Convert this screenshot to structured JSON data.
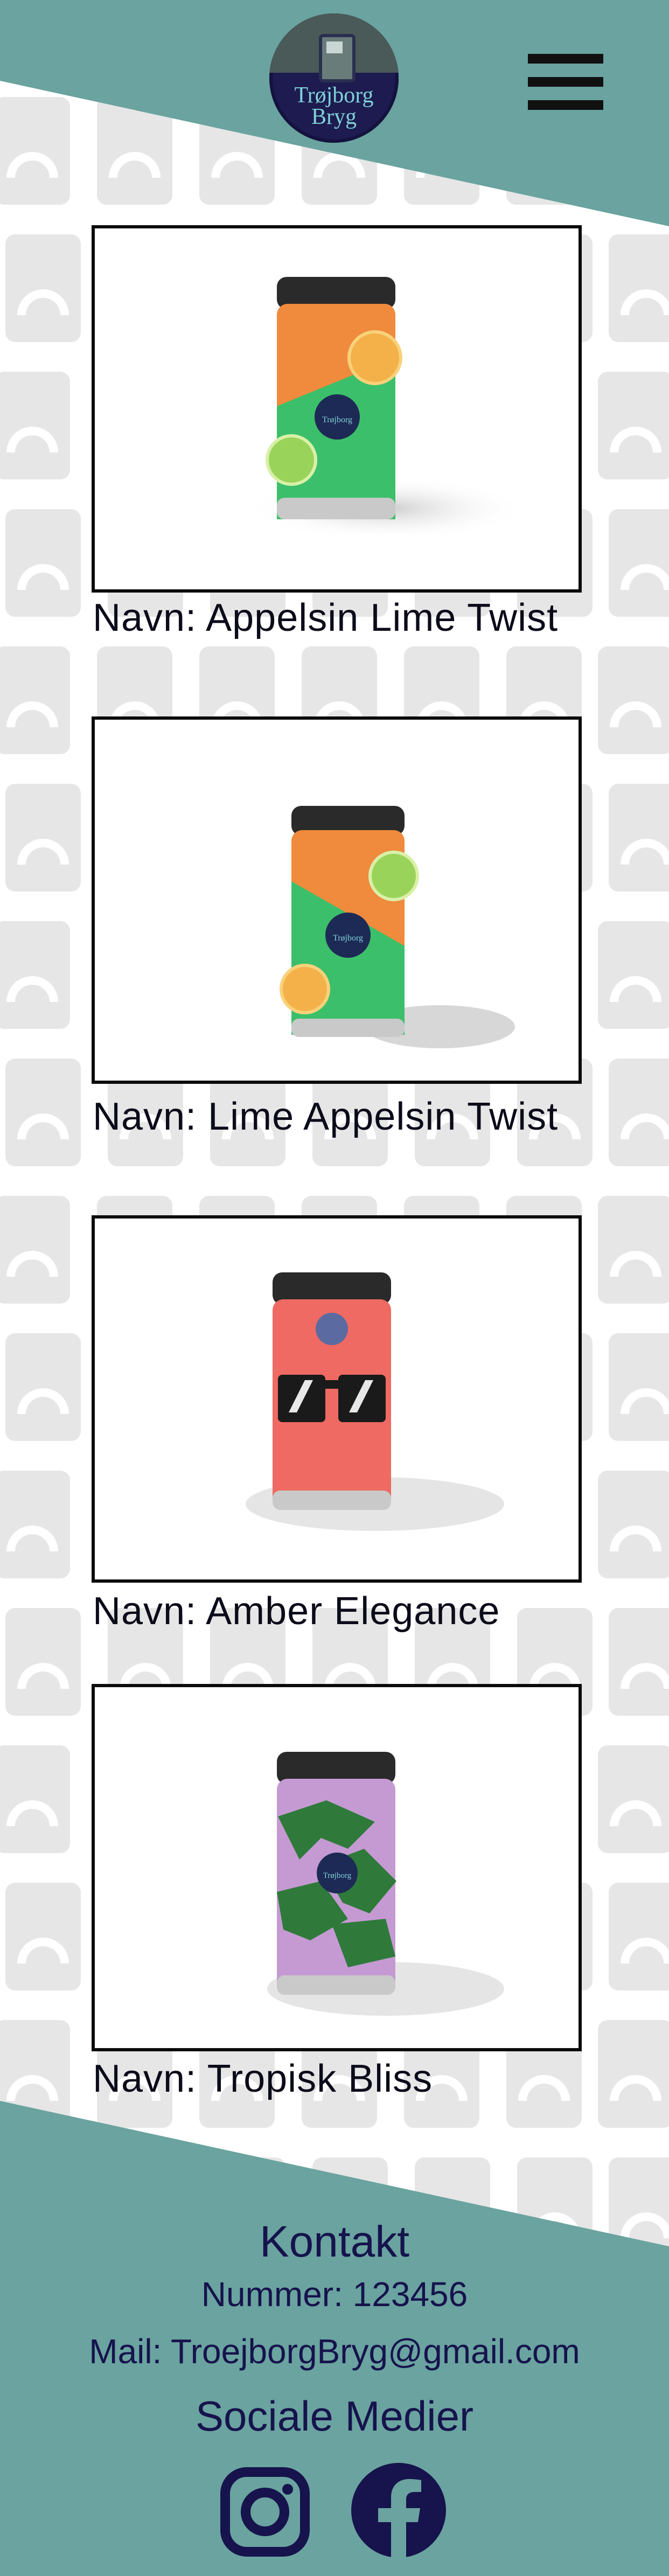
{
  "header": {
    "logo_text_line1": "Trøjborg",
    "logo_text_line2": "Bryg",
    "menu_icon": "hamburger-menu-icon"
  },
  "products": [
    {
      "label": "Navn: Appelsin  Lime  Twist",
      "can": "orange-green-citrus-can"
    },
    {
      "label": "Navn: Lime  Appelsin  Twist",
      "can": "orange-green-lime-can"
    },
    {
      "label": "Navn: Amber  Elegance",
      "can": "red-sunglasses-can"
    },
    {
      "label": "Navn: Tropisk  Bliss",
      "can": "purple-leaf-can"
    }
  ],
  "footer": {
    "heading": "Kontakt",
    "phone": "Nummer: 123456",
    "mail": "Mail: TroejborgBryg@gmail.com",
    "social_heading": "Sociale  Medier",
    "instagram_icon": "instagram-icon",
    "facebook_icon": "facebook-icon"
  },
  "colors": {
    "teal": "#6aa39f",
    "navy": "#16134d",
    "pattern": "#e6e6e6"
  }
}
